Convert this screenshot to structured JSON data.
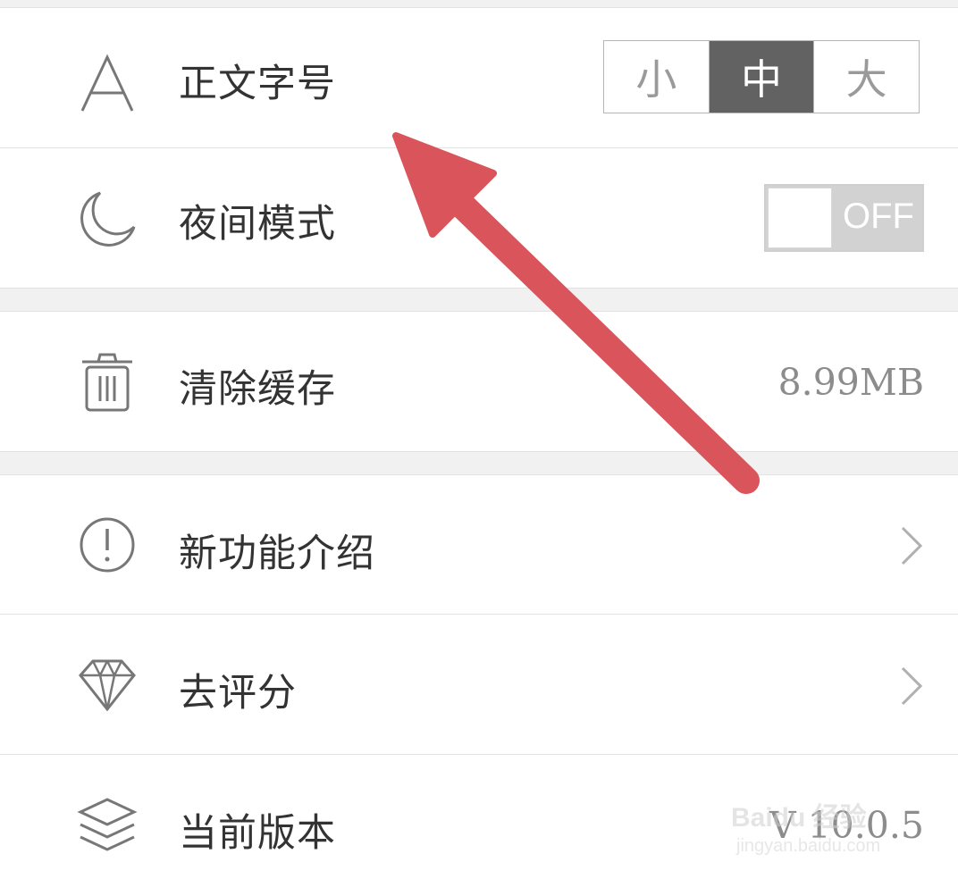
{
  "display": {
    "font_size_label": "正文字号",
    "font_size_options": [
      "小",
      "中",
      "大"
    ],
    "font_size_selected": "中",
    "night_mode_label": "夜间模式",
    "night_mode_state": "OFF"
  },
  "storage": {
    "clear_cache_label": "清除缓存",
    "cache_size": "8.99MB"
  },
  "about": {
    "new_features_label": "新功能介绍",
    "rate_label": "去评分",
    "version_label": "当前版本",
    "version_value": "V 10.0.5"
  },
  "watermark": {
    "brand": "Baidu 经验",
    "url": "jingyan.baidu.com"
  },
  "icons": [
    "letter-a-icon",
    "moon-icon",
    "trash-icon",
    "info-icon",
    "diamond-icon",
    "layers-icon",
    "chevron-right-icon"
  ],
  "colors": {
    "accent_arrow": "#d9545b",
    "segment_active": "#626262",
    "toggle_off": "#d2d2d2"
  }
}
